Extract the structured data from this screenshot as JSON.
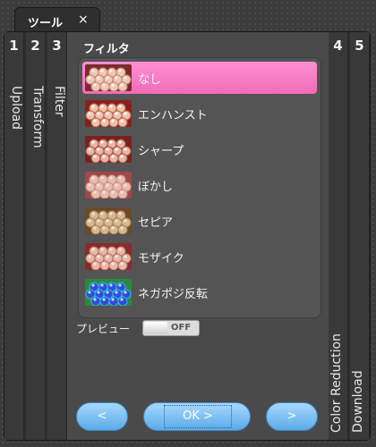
{
  "tab": {
    "title": "ツール",
    "close": "×"
  },
  "steps": [
    {
      "number": "1",
      "label": "Upload"
    },
    {
      "number": "2",
      "label": "Transform"
    },
    {
      "number": "3",
      "label": "Filter"
    },
    {
      "number": "4",
      "label": "Color Reduction"
    },
    {
      "number": "5",
      "label": "Download"
    }
  ],
  "filter": {
    "title": "フィルタ",
    "items": [
      {
        "label": "なし",
        "selected": true,
        "style": "normal"
      },
      {
        "label": "エンハンスト",
        "selected": false,
        "style": "enhanced"
      },
      {
        "label": "シャープ",
        "selected": false,
        "style": "sharp"
      },
      {
        "label": "ぼかし",
        "selected": false,
        "style": "blur"
      },
      {
        "label": "セピア",
        "selected": false,
        "style": "sepia"
      },
      {
        "label": "モザイク",
        "selected": false,
        "style": "mosaic"
      },
      {
        "label": "ネガポジ反転",
        "selected": false,
        "style": "negative"
      }
    ]
  },
  "preview": {
    "label": "プレビュー",
    "toggle_text": "OFF",
    "enabled": false
  },
  "nav": {
    "prev": "<",
    "ok": "OK >",
    "next": ">"
  },
  "colors": {
    "selected_item": "#f06cb8",
    "button": "#5aaae8"
  }
}
